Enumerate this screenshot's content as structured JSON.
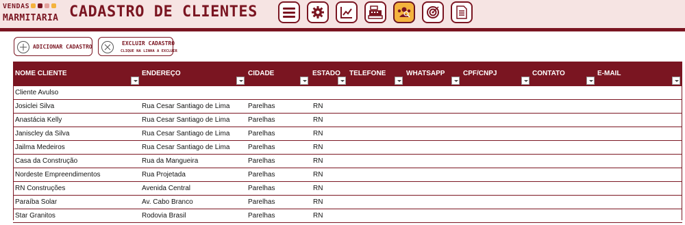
{
  "header": {
    "logo_line1": "VENDAS",
    "logo_line2": "MARMITARIA",
    "title": "CADASTRO DE CLIENTES",
    "nav": [
      {
        "icon": "menu-icon"
      },
      {
        "icon": "gear-icon"
      },
      {
        "icon": "chart-icon"
      },
      {
        "icon": "cash-register-icon"
      },
      {
        "icon": "clients-icon",
        "active": true
      },
      {
        "icon": "target-icon"
      },
      {
        "icon": "document-icon"
      }
    ]
  },
  "actions": {
    "add_label": "ADICIONAR CADASTRO",
    "delete_label": "EXCLUIR CADASTRO",
    "delete_hint": "CLIQUE NA LINHA A EXCLUIR"
  },
  "table": {
    "headers": [
      "NOME CLIENTE",
      "ENDEREÇO",
      "CIDADE",
      "ESTADO",
      "TELEFONE",
      "WHATSAPP",
      "CPF/CNPJ",
      "CONTATO",
      "E-MAIL"
    ],
    "rows": [
      [
        "Cliente Avulso",
        "",
        "",
        "",
        "",
        "",
        "",
        "",
        ""
      ],
      [
        "Josiclei Silva",
        "Rua Cesar Santiago de Lima",
        "Parelhas",
        "RN",
        "",
        "",
        "",
        "",
        ""
      ],
      [
        "Anastácia Kelly",
        "Rua Cesar Santiago de Lima",
        "Parelhas",
        "RN",
        "",
        "",
        "",
        "",
        ""
      ],
      [
        "Janiscley da Silva",
        "Rua Cesar Santiago de Lima",
        "Parelhas",
        "RN",
        "",
        "",
        "",
        "",
        ""
      ],
      [
        "Jailma Medeiros",
        "Rua Cesar Santiago de Lima",
        "Parelhas",
        "RN",
        "",
        "",
        "",
        "",
        ""
      ],
      [
        "Casa da Construção",
        "Rua da Mangueira",
        "Parelhas",
        "RN",
        "",
        "",
        "",
        "",
        ""
      ],
      [
        "Nordeste Empreendimentos",
        "Rua Projetada",
        "Parelhas",
        "RN",
        "",
        "",
        "",
        "",
        ""
      ],
      [
        "RN Construções",
        "Avenida Central",
        "Parelhas",
        "RN",
        "",
        "",
        "",
        "",
        ""
      ],
      [
        "Paraíba Solar",
        "Av. Cabo Branco",
        "Parelhas",
        "RN",
        "",
        "",
        "",
        "",
        ""
      ],
      [
        "Star Granitos",
        "Rodovia Brasil",
        "Parelhas",
        "RN",
        "",
        "",
        "",
        "",
        ""
      ]
    ]
  },
  "colors": {
    "brand": "#7a1521",
    "header_bg": "#f6e4e3",
    "active_nav": "#f4b33d"
  }
}
